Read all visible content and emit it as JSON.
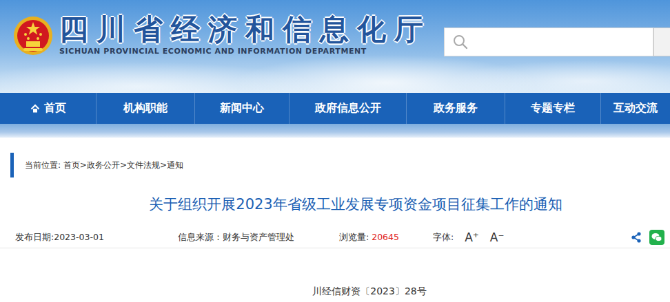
{
  "header": {
    "title": "四川省经济和信息化厅",
    "subtitle": "SICHUAN PROVINCIAL ECONOMIC AND INFORMATION DEPARTMENT"
  },
  "nav": [
    {
      "label": "首页",
      "kind": "home",
      "selected": false
    },
    {
      "label": "机构职能",
      "kind": "link",
      "selected": false
    },
    {
      "label": "新闻中心",
      "kind": "link",
      "selected": false
    },
    {
      "label": "政府信息公开",
      "kind": "link",
      "selected": false
    },
    {
      "label": "政务服务",
      "kind": "link",
      "selected": false
    },
    {
      "label": "专题专栏",
      "kind": "link",
      "selected": false
    },
    {
      "label": "互动交流",
      "kind": "link",
      "selected": false
    }
  ],
  "breadcrumb": "当前位置: 首页>政务公开>文件法规>通知",
  "article": {
    "title": "关于组织开展2023年省级工业发展专项资金项目征集工作的通知",
    "meta": {
      "date": "发布日期:2023-03-01",
      "source": "信息来源：财务与资产管理处",
      "views_label": "浏览量:",
      "views": "20645",
      "font_label": "字体:",
      "font_buttons": [
        "A⁺",
        "A⁻"
      ]
    },
    "doc_number": "川经信财资〔2023〕28号"
  }
}
